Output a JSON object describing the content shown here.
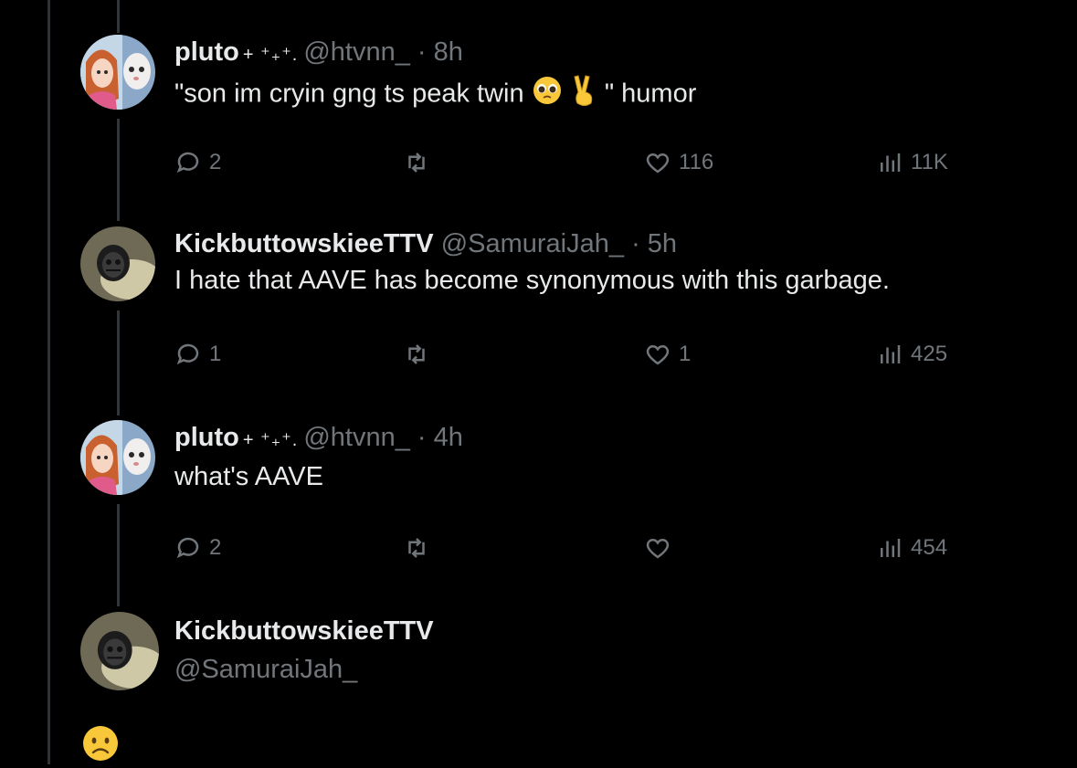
{
  "tweets": [
    {
      "name": "pluto",
      "sparkle": "+ ⁺₊⁺.",
      "handle": "@htvnn_",
      "dot": "·",
      "time": "8h",
      "text_before": "\"son im cryin gng ts peak twin",
      "text_after": " \" humor",
      "emojis": [
        "pleading-face",
        "victory-hand"
      ],
      "reply_count": "2",
      "repost_count": "",
      "like_count": "116",
      "view_count": "11K"
    },
    {
      "name": "KickbuttowskieeTTV",
      "handle": "@SamuraiJah_",
      "dot": "·",
      "time": "5h",
      "text": "I hate that AAVE has become synonymous with this garbage.",
      "reply_count": "1",
      "repost_count": "",
      "like_count": "1",
      "view_count": "425"
    },
    {
      "name": "pluto",
      "sparkle": "+ ⁺₊⁺.",
      "handle": "@htvnn_",
      "dot": "·",
      "time": "4h",
      "text": "what's AAVE",
      "reply_count": "2",
      "repost_count": "",
      "like_count": "",
      "view_count": "454"
    },
    {
      "name": "KickbuttowskieeTTV",
      "handle": "@SamuraiJah_",
      "text": "☹"
    }
  ],
  "icons": {
    "reply": "reply-icon",
    "repost": "repost-icon",
    "like": "heart-icon",
    "views": "views-icon"
  },
  "colors": {
    "background": "#000000",
    "text": "#e7e9ea",
    "muted": "#71767b"
  }
}
